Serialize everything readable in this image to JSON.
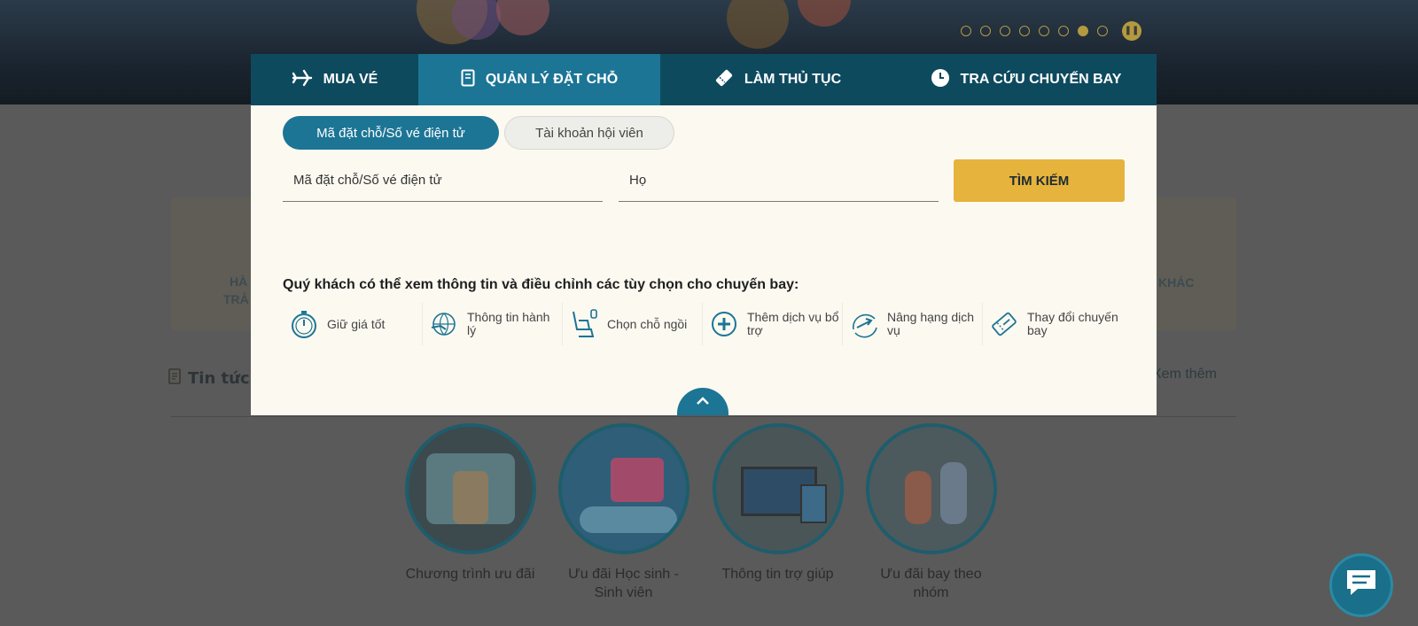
{
  "tabs": [
    {
      "label": "MUA VÉ",
      "icon": "airplane-icon"
    },
    {
      "label": "QUẢN LÝ ĐẶT CHỖ",
      "icon": "booking-book-icon"
    },
    {
      "label": "LÀM THỦ TỤC",
      "icon": "ticket-icon"
    },
    {
      "label": "TRA CỨU CHUYẾN BAY",
      "icon": "clock-icon"
    }
  ],
  "active_tab": "QUẢN LÝ ĐẶT CHỖ",
  "pills": {
    "booking_code": "Mã đặt chỗ/Số vé điện tử",
    "member_account": "Tài khoản hội viên"
  },
  "form": {
    "booking_placeholder": "Mã đặt chỗ/Số vé điện tử",
    "last_name_placeholder": "Họ",
    "search_label": "TÌM KIẾM"
  },
  "info": {
    "heading": "Quý khách có thể xem thông tin và điều chỉnh các tùy chọn cho chuyến bay:",
    "options": [
      {
        "label": "Giữ giá tốt",
        "icon": "stopwatch-icon"
      },
      {
        "label": "Thông tin hành lý",
        "icon": "baggage-icon"
      },
      {
        "label": "Chọn chỗ ngồi",
        "icon": "seat-icon"
      },
      {
        "label": "Thêm dịch vụ bổ trợ",
        "icon": "plus-circle-icon"
      },
      {
        "label": "Nâng hạng dịch vụ",
        "icon": "upgrade-plane-icon"
      },
      {
        "label": "Thay đổi chuyến bay",
        "icon": "change-ticket-icon"
      }
    ]
  },
  "background": {
    "news_heading": "Tin tức",
    "see_more": "Xem thêm",
    "quick_other": "KHÁC",
    "quick_left_top": "HÀ",
    "quick_left_bottom": "TRẢ",
    "promos": [
      "Chương trình ưu đãi",
      "Ưu đãi Học sinh - Sinh viên",
      "Thông tin trợ giúp",
      "Ưu đãi bay theo nhóm"
    ]
  },
  "colors": {
    "tab_bar": "#0e4a5e",
    "tab_active": "#1c7595",
    "search_button": "#e6b33c",
    "modal_bg": "#fcf9f1"
  }
}
